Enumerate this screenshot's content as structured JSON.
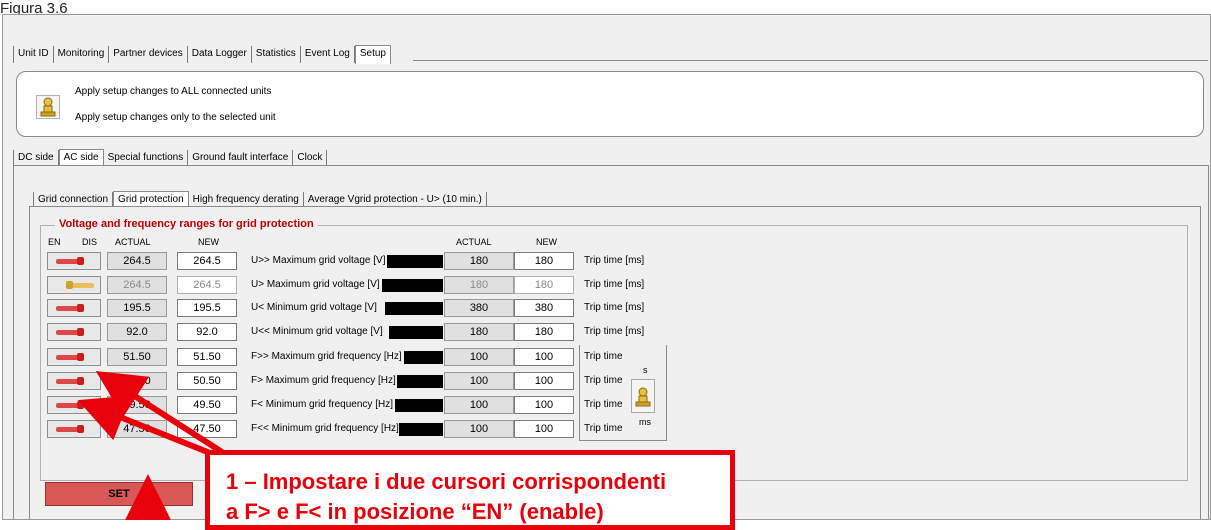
{
  "caption": "Figura 3.6",
  "main_tabs": [
    {
      "label": "Unit ID",
      "active": false
    },
    {
      "label": "Monitoring",
      "active": false
    },
    {
      "label": "Partner devices",
      "active": false
    },
    {
      "label": "Data Logger",
      "active": false
    },
    {
      "label": "Statistics",
      "active": false
    },
    {
      "label": "Event Log",
      "active": false
    },
    {
      "label": "Setup",
      "active": true
    }
  ],
  "apply": {
    "all_units": "Apply setup changes to ALL connected units",
    "selected_unit": "Apply setup changes only to the selected unit",
    "icon": "pawn-icon"
  },
  "setup_tabs": [
    {
      "label": "DC side",
      "active": false
    },
    {
      "label": "AC side",
      "active": true
    },
    {
      "label": "Special functions",
      "active": false
    },
    {
      "label": "Ground fault interface",
      "active": false
    },
    {
      "label": "Clock",
      "active": false
    }
  ],
  "ac_tabs": [
    {
      "label": "Grid connection",
      "active": false
    },
    {
      "label": "Grid protection",
      "active": true
    },
    {
      "label": "High frequency derating",
      "active": false
    },
    {
      "label": "Average Vgrid protection - U> (10 min.)",
      "active": false
    }
  ],
  "group_title": "Voltage and frequency ranges for grid protection",
  "headers": {
    "en": "EN",
    "dis": "DIS",
    "actual": "ACTUAL",
    "new": "NEW",
    "actual2": "ACTUAL",
    "new2": "NEW"
  },
  "rows": [
    {
      "enabled": true,
      "actual": "264.5",
      "new": "264.5",
      "label": "U>> Maximum grid voltage [V]",
      "actual2": "180",
      "new2": "180",
      "trip": "Trip time [ms]"
    },
    {
      "enabled": false,
      "actual": "264.5",
      "new": "264.5",
      "label": "U> Maximum grid voltage [V]",
      "actual2": "180",
      "new2": "180",
      "trip": "Trip time [ms]"
    },
    {
      "enabled": true,
      "actual": "195.5",
      "new": "195.5",
      "label": "U< Minimum grid voltage [V]",
      "actual2": "380",
      "new2": "380",
      "trip": "Trip time [ms]"
    },
    {
      "enabled": true,
      "actual": "92.0",
      "new": "92.0",
      "label": "U<< Minimum grid voltage [V]",
      "actual2": "180",
      "new2": "180",
      "trip": "Trip time [ms]"
    },
    {
      "enabled": true,
      "actual": "51.50",
      "new": "51.50",
      "label": "F>> Maximum grid frequency [Hz]",
      "actual2": "100",
      "new2": "100",
      "trip": "Trip time"
    },
    {
      "enabled": true,
      "actual": "50.50",
      "new": "50.50",
      "label": "F> Maximum grid frequency [Hz]",
      "actual2": "100",
      "new2": "100",
      "trip": "Trip time"
    },
    {
      "enabled": true,
      "actual": "49.50",
      "new": "49.50",
      "label": "F< Minimum grid frequency [Hz]",
      "actual2": "100",
      "new2": "100",
      "trip": "Trip time"
    },
    {
      "enabled": true,
      "actual": "47.50",
      "new": "47.50",
      "label": "F<< Minimum grid frequency [Hz]",
      "actual2": "100",
      "new2": "100",
      "trip": "Trip time"
    }
  ],
  "unit_selector": {
    "s": "s",
    "ms": "ms"
  },
  "set_button": "SET",
  "annotation": {
    "line1": "1 – Impostare i due cursori corrispondenti",
    "line2": "a F> e F< in posizione “EN” (enable)",
    "color": "#e8000a"
  },
  "colors": {
    "enabled_toggle": "#e04848",
    "disabled_toggle": "#e8c060",
    "set_button": "#d85858"
  }
}
